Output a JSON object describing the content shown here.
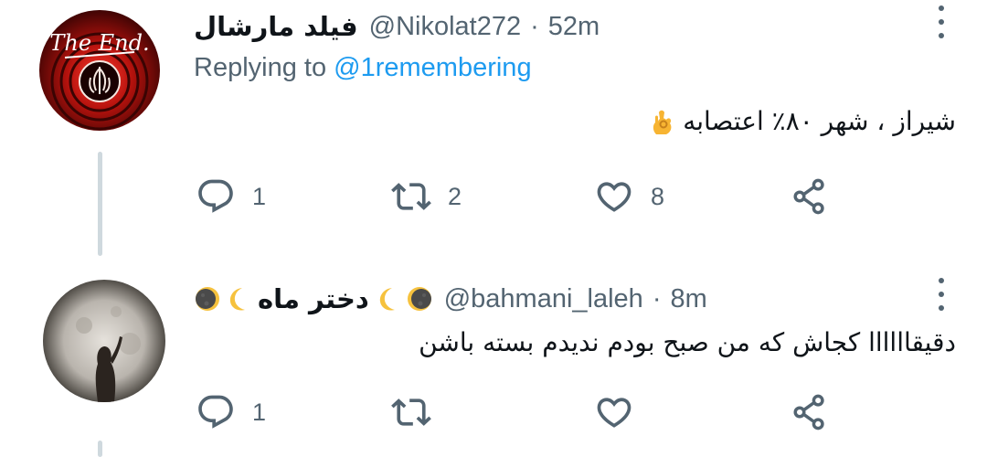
{
  "tweets": [
    {
      "name": "فیلد مارشال",
      "handle": "@Nikolat272",
      "separator": "·",
      "time": "52m",
      "replying_prefix": "Replying to",
      "replying_to": "@1remembering",
      "avatar_text": "The End.",
      "body": "شیراز ، شهر ۸۰٪ اعتصابه",
      "body_emoji": "ok-hand-emoji",
      "reply_count": "1",
      "retweet_count": "2",
      "like_count": "8"
    },
    {
      "name": "دختر ماه",
      "handle": "@bahmani_laleh",
      "separator": "·",
      "time": "8m",
      "body": "دقیقاااااا کجاش که من صبح بودم ندیدم بسته باشن",
      "reply_count": "1",
      "retweet_count": "",
      "like_count": ""
    }
  ],
  "icons": {
    "reply": "reply-icon",
    "retweet": "retweet-icon",
    "like": "heart-icon",
    "share": "share-icon",
    "more": "more-icon",
    "moon": "crescent-moon-icon",
    "dark_moon": "dark-moon-icon"
  },
  "colors": {
    "text": "#0f1419",
    "muted": "#536471",
    "accent": "#1d9bf0",
    "thread_line": "#cfd9de"
  }
}
